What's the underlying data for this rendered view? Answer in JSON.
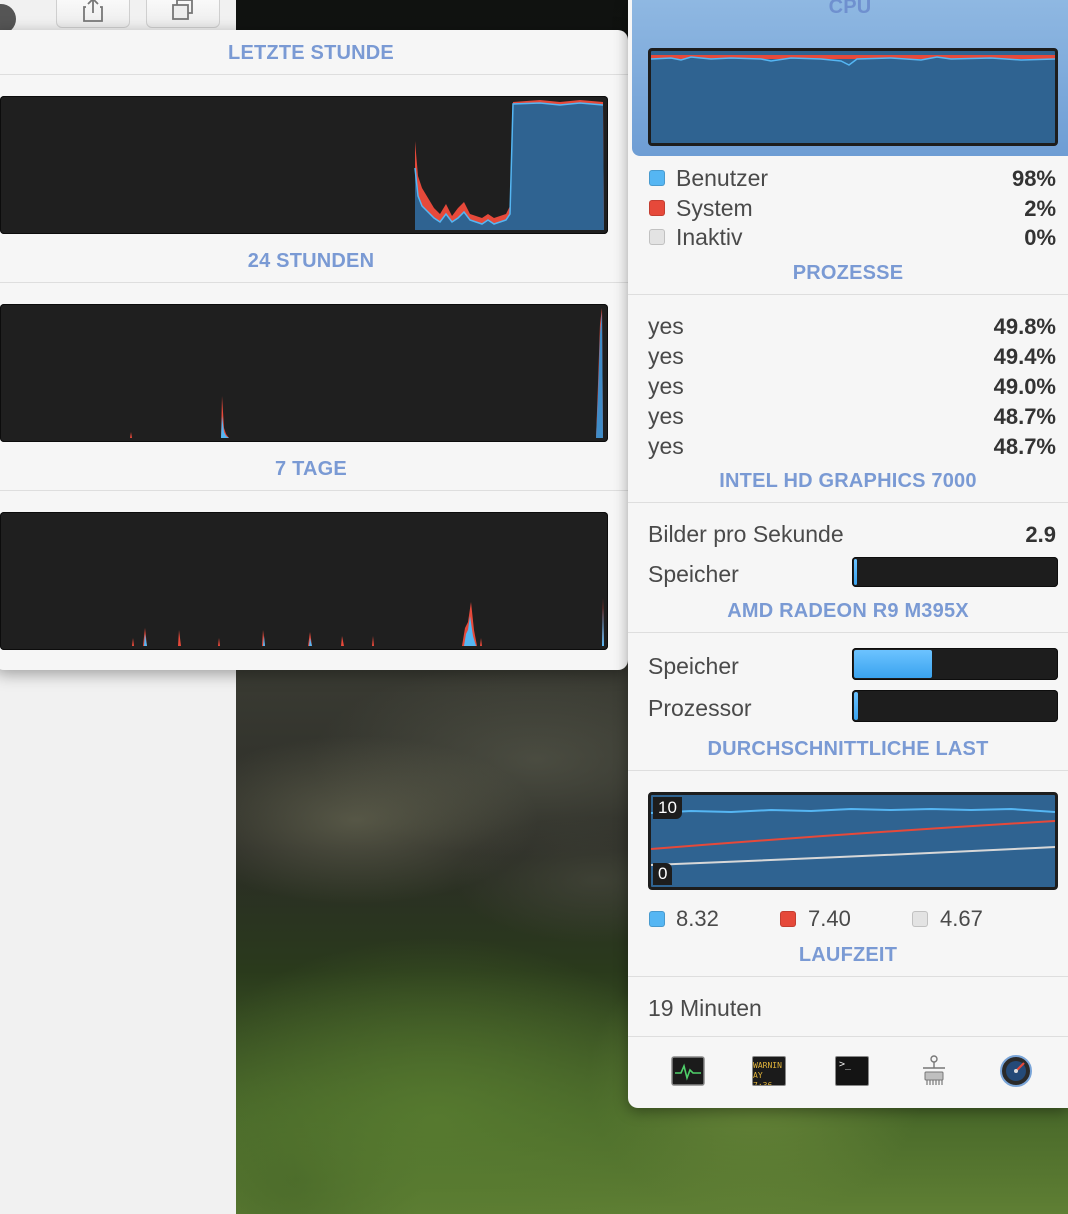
{
  "history": {
    "sections": [
      {
        "title": "LETZTE STUNDE"
      },
      {
        "title": "24 STUNDEN"
      },
      {
        "title": "7 TAGE"
      }
    ]
  },
  "cpu": {
    "title": "CPU",
    "legend": [
      {
        "label": "Benutzer",
        "value": "98%",
        "color": "#55b6f3"
      },
      {
        "label": "System",
        "value": "2%",
        "color": "#e6493a"
      },
      {
        "label": "Inaktiv",
        "value": "0%",
        "color": "#e3e3e3"
      }
    ]
  },
  "processes": {
    "title": "PROZESSE",
    "items": [
      {
        "name": "yes",
        "value": "49.8%"
      },
      {
        "name": "yes",
        "value": "49.4%"
      },
      {
        "name": "yes",
        "value": "49.0%"
      },
      {
        "name": "yes",
        "value": "48.7%"
      },
      {
        "name": "yes",
        "value": "48.7%"
      }
    ]
  },
  "intel_gpu": {
    "title": "INTEL HD GRAPHICS 7000",
    "fps_label": "Bilder pro Sekunde",
    "fps_value": "2.9",
    "memory_label": "Speicher",
    "memory_fill": 0.01
  },
  "amd_gpu": {
    "title": "AMD RADEON R9 M395X",
    "memory_label": "Speicher",
    "memory_fill": 0.4,
    "processor_label": "Prozessor",
    "processor_fill": 0.04
  },
  "load": {
    "title": "DURCHSCHNITTLICHE LAST",
    "scale_max": "10",
    "scale_min": "0",
    "values": [
      {
        "value": "8.32",
        "color": "#55b6f3"
      },
      {
        "value": "7.40",
        "color": "#e6493a"
      },
      {
        "value": "4.67",
        "color": "#e3e3e3"
      }
    ]
  },
  "uptime": {
    "title": "LAUFZEIT",
    "value": "19 Minuten"
  },
  "dock": {
    "terminal_prompt": ">_",
    "console_text": [
      "WARNIN",
      "AY 7:36"
    ]
  },
  "colors": {
    "accent": "#7a9ad4",
    "user": "#55b6f3",
    "system": "#e6493a",
    "idle": "#e3e3e3",
    "graph_fill": "#2f6391"
  }
}
